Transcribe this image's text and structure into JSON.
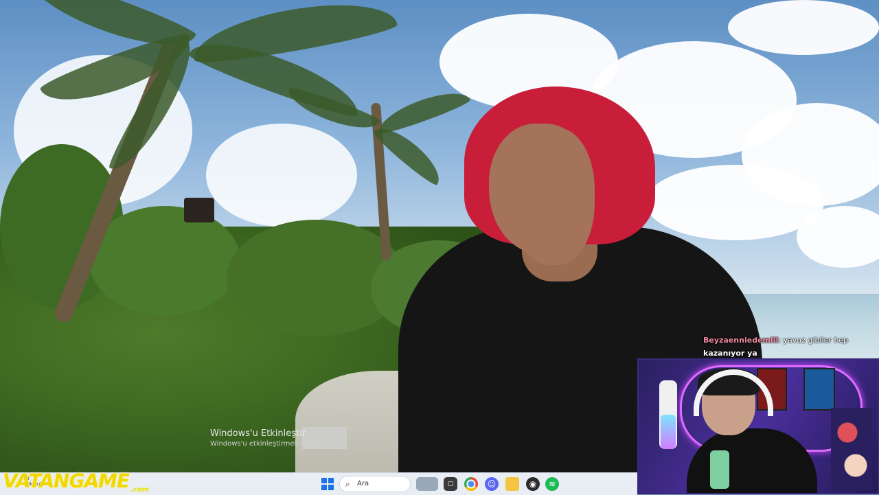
{
  "activation": {
    "title": "Windows'u Etkinleştir",
    "subtitle": "Windows'u etkinleştirmek için A"
  },
  "chat": {
    "username": "Beyzaenniedemlil",
    "message_part1": ": yavuz gibiler hep",
    "message_part2": "kazanıyor ya"
  },
  "taskbar": {
    "clock_line1": "13",
    "clock_line2": "Çok bulutlu",
    "search_placeholder": "Ara",
    "search_icon": "search-icon",
    "icons": [
      "windows-start-icon",
      "browser-tab-icon",
      "task-view-icon",
      "chrome-icon",
      "discord-icon",
      "file-explorer-icon",
      "obs-icon",
      "spotify-icon"
    ]
  },
  "watermark": {
    "brand": "VATANGAME",
    "suffix": ".com"
  },
  "colors": {
    "bandana": "#c81e3a",
    "chat_user": "#f08aa0",
    "watermark": "#f0d800",
    "taskbar": "#e9edf4"
  }
}
